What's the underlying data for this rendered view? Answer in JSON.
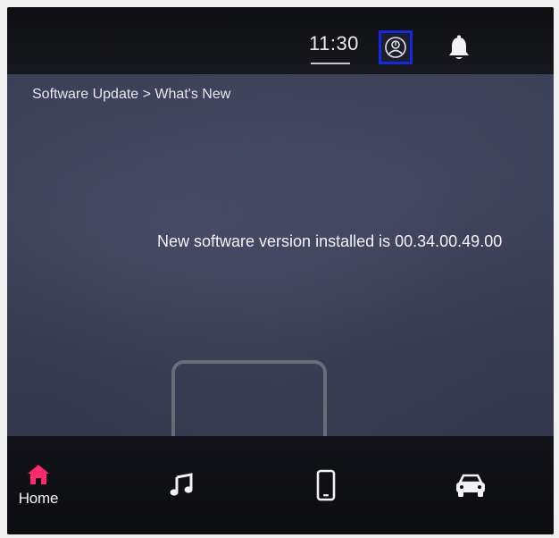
{
  "status_bar": {
    "time": "11:30",
    "icons": [
      "profile-icon",
      "bell-icon"
    ],
    "profile_highlight_color": "#1428e6"
  },
  "content": {
    "breadcrumb": "Software Update > What's New",
    "message": "New software version installed is 00.34.00.49.00"
  },
  "nav": {
    "items": [
      {
        "icon": "home-icon",
        "label": "Home",
        "active": true,
        "color": "#ff2a6d"
      },
      {
        "icon": "music-icon",
        "label": "",
        "active": false
      },
      {
        "icon": "phone-icon",
        "label": "",
        "active": false
      },
      {
        "icon": "car-icon",
        "label": "",
        "active": false
      }
    ]
  }
}
